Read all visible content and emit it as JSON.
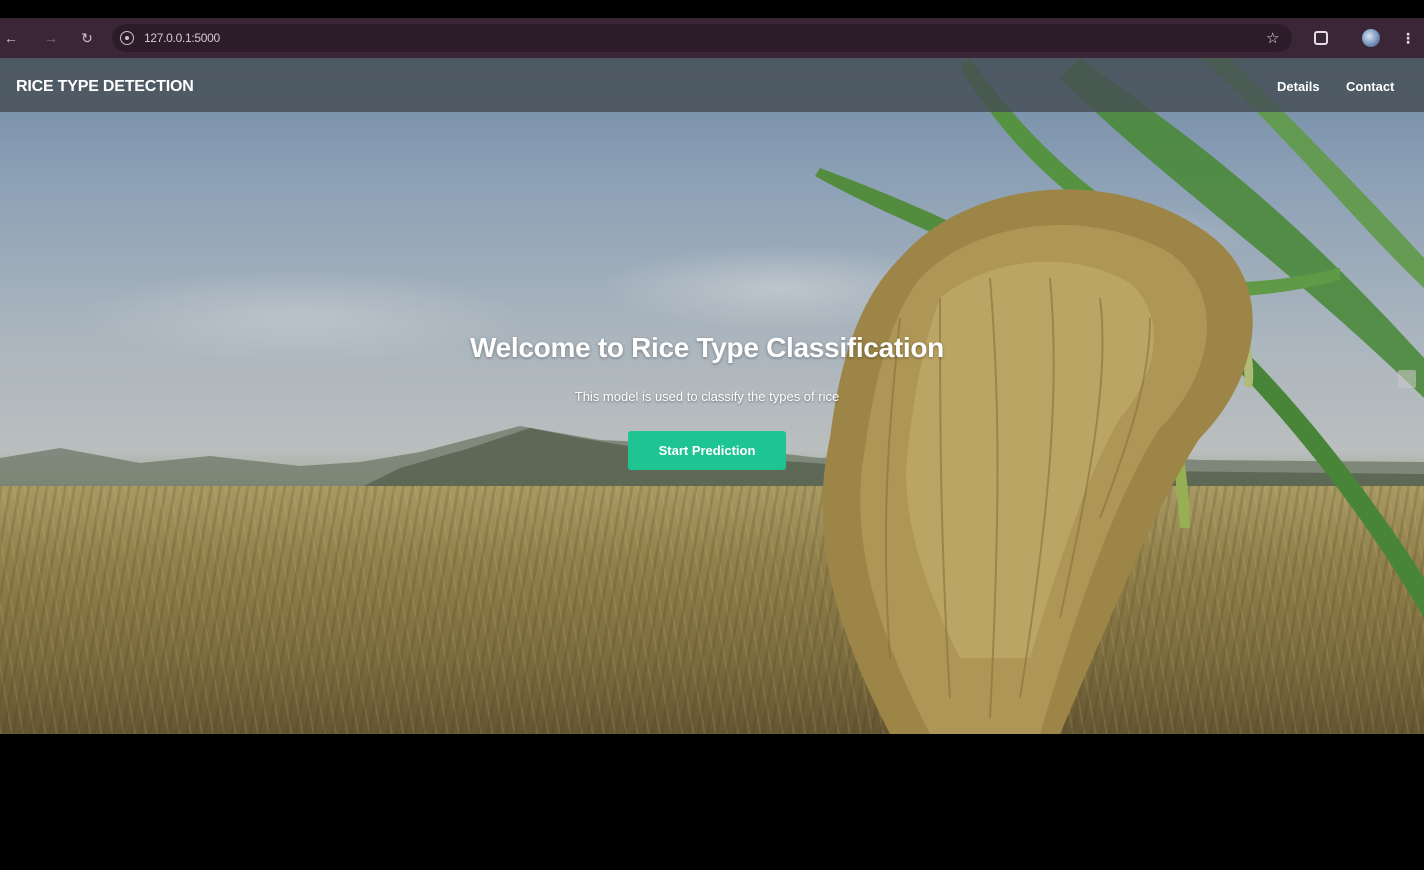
{
  "browser": {
    "url": "127.0.0.1:5000",
    "icons": [
      "back-icon",
      "forward-icon",
      "reload-icon",
      "site-info-icon",
      "bookmark-star-icon",
      "extensions-icon",
      "profile-avatar-icon",
      "menu-kebab-icon"
    ]
  },
  "navbar": {
    "brand": "RICE TYPE DETECTION",
    "links": [
      "Details",
      "Contact"
    ]
  },
  "hero": {
    "title": "Welcome to Rice Type Classification",
    "subtitle": "This model is used to classify the types of rice",
    "cta_label": "Start Prediction"
  },
  "colors": {
    "browser_bar": "#3b2638",
    "navbar": "#464e54",
    "cta": "#1fc493"
  }
}
